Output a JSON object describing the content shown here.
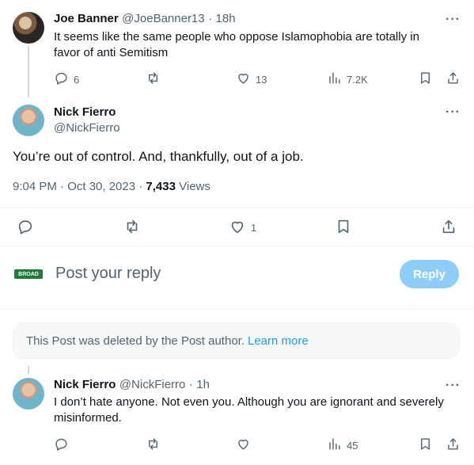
{
  "tweet1": {
    "author_name": "Joe Banner",
    "handle": "@JoeBanner13",
    "sep": "·",
    "time": "18h",
    "text": "It seems like the same people who oppose Islamophobia are totally in favor of anti Semitism",
    "replies": "6",
    "likes": "13",
    "views": "7.2K"
  },
  "main_tweet": {
    "author_name": "Nick Fierro",
    "handle": "@NickFierro",
    "text": "You’re out of control. And, thankfully, out of a job.",
    "time": "9:04 PM · Oct 30, 2023 ·",
    "views_count": "7,433",
    "views_label": "Views",
    "likes": "1"
  },
  "compose": {
    "logo_text": "BROAD",
    "placeholder": "Post your reply",
    "reply_button": "Reply"
  },
  "deleted_notice": {
    "text": "This Post was deleted by the Post author.",
    "link": "Learn more"
  },
  "tweet3": {
    "author_name": "Nick Fierro",
    "handle": "@NickFierro",
    "sep": "·",
    "time": "1h",
    "text": "I don’t hate anyone. Not even you. Although you are ignorant and severely misinformed.",
    "views": "45"
  },
  "icons": {
    "more": "more-horizontal-icon",
    "reply": "reply-icon",
    "retweet": "retweet-icon",
    "like": "heart-icon",
    "views": "views-icon",
    "bookmark": "bookmark-icon",
    "share": "share-icon"
  },
  "colors": {
    "accent": "#1d9bf0",
    "reply_button_disabled": "#8ecdf8",
    "muted_text": "#536471"
  }
}
